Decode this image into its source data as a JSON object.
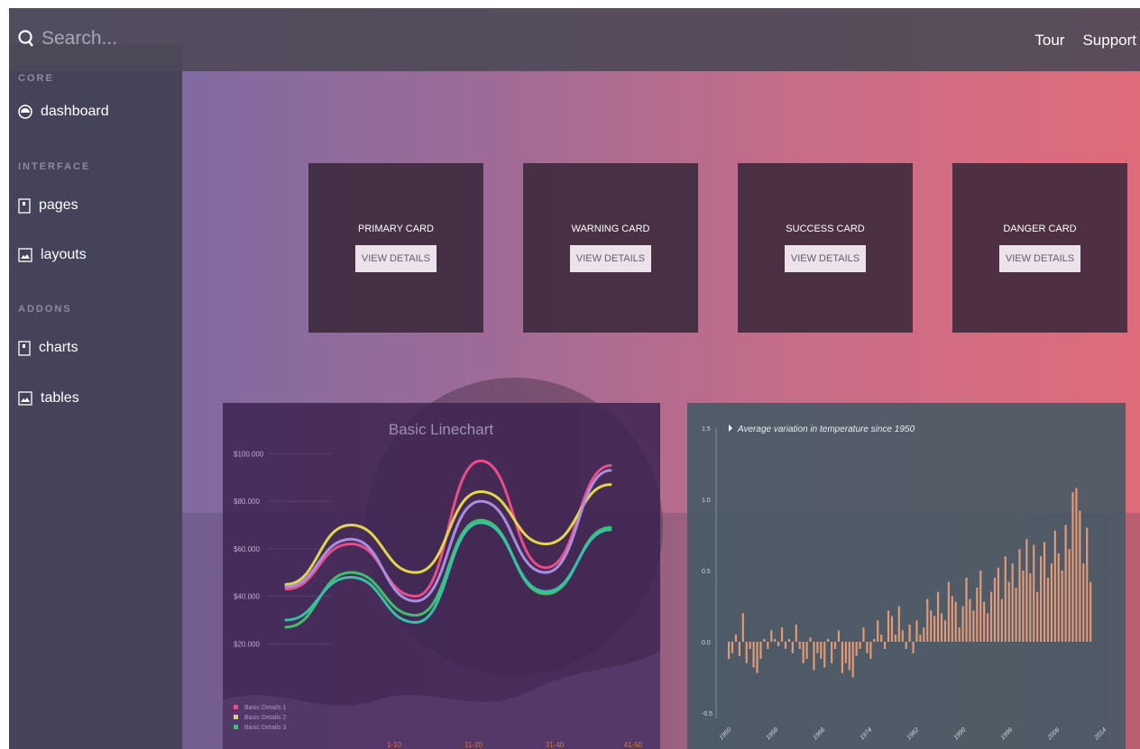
{
  "topbar": {
    "search_placeholder": "Search...",
    "nav": [
      "Tour",
      "Support"
    ]
  },
  "sidebar": {
    "sections": {
      "core": "CORE",
      "interface": "INTERFACE",
      "addons": "ADDONS"
    },
    "items": [
      {
        "label": "dashboard",
        "icon": "dashboard-icon"
      },
      {
        "label": "pages",
        "icon": "page-icon"
      },
      {
        "label": "layouts",
        "icon": "image-icon"
      },
      {
        "label": "charts",
        "icon": "page-icon"
      },
      {
        "label": "tables",
        "icon": "image-icon"
      }
    ]
  },
  "cards": [
    {
      "title": "PRIMARY CARD",
      "button": "VIEW DETAILS"
    },
    {
      "title": "WARNING CARD",
      "button": "VIEW DETAILS"
    },
    {
      "title": "SUCCESS CARD",
      "button": "VIEW DETAILS"
    },
    {
      "title": "DANGER CARD",
      "button": "VIEW DETAILS"
    }
  ],
  "chart_data": [
    {
      "type": "line",
      "title": "Basic Linechart",
      "y_ticks": [
        "$100.000",
        "$80.000",
        "$60.000",
        "$40.000",
        "$20.000"
      ],
      "ylim": [
        0,
        110000
      ],
      "categories": [
        "1-10",
        "11-20",
        "31-40",
        "41-50"
      ],
      "series": [
        {
          "name": "Basic Details 1",
          "color": "#e84d8a",
          "values": [
            43000,
            62000,
            40000,
            97000,
            52000,
            95000
          ]
        },
        {
          "name": "Basic Details 2",
          "color": "#e2d64a",
          "values": [
            45000,
            70000,
            50000,
            84000,
            62000,
            87000
          ]
        },
        {
          "name": "Basic Details 3",
          "color": "#3fbf6a",
          "values": [
            27000,
            50000,
            32000,
            72000,
            41000,
            69000
          ]
        },
        {
          "color": "#a88ee0",
          "values": [
            44000,
            64000,
            38000,
            80000,
            50000,
            93000
          ]
        },
        {
          "color": "#36c0a8",
          "values": [
            30000,
            48000,
            29000,
            71000,
            42000,
            68000
          ]
        }
      ]
    },
    {
      "type": "bar",
      "title": "Average variation in temperature since 1950",
      "y_ticks": [
        "1.5",
        "1.0",
        "0.5",
        "0.0",
        "-0.5"
      ],
      "ylim": [
        -0.5,
        1.5
      ],
      "x_ticks": [
        "1950",
        "1958",
        "1966",
        "1974",
        "1982",
        "1990",
        "1998",
        "2006",
        "2014"
      ],
      "bar_color": "#e39a78",
      "values": [
        -0.12,
        -0.08,
        0.05,
        -0.1,
        0.2,
        -0.15,
        -0.05,
        -0.18,
        -0.22,
        -0.12,
        0.02,
        -0.05,
        0.08,
        0.02,
        -0.03,
        0.1,
        -0.05,
        0.02,
        -0.08,
        0.12,
        -0.05,
        -0.15,
        -0.12,
        0.03,
        -0.2,
        -0.08,
        -0.12,
        -0.18,
        0.02,
        -0.15,
        -0.05,
        0.08,
        -0.22,
        -0.15,
        -0.2,
        -0.25,
        -0.1,
        -0.05,
        0.1,
        -0.08,
        -0.12,
        0.02,
        0.15,
        0.05,
        -0.05,
        0.22,
        0.18,
        0.05,
        0.25,
        0.08,
        -0.05,
        0.12,
        -0.08,
        0.15,
        0.05,
        0.1,
        0.3,
        0.22,
        0.18,
        0.35,
        0.2,
        0.15,
        0.42,
        0.32,
        0.28,
        0.1,
        0.25,
        0.45,
        0.3,
        0.22,
        0.38,
        0.5,
        0.28,
        0.2,
        0.35,
        0.45,
        0.52,
        0.3,
        0.6,
        0.42,
        0.55,
        0.38,
        0.65,
        0.5,
        0.72,
        0.48,
        0.68,
        0.35,
        0.6,
        0.7,
        0.45,
        0.55,
        0.78,
        0.62,
        0.5,
        0.82,
        0.65,
        1.05,
        1.08,
        0.92,
        0.55,
        0.8,
        0.42
      ]
    }
  ]
}
